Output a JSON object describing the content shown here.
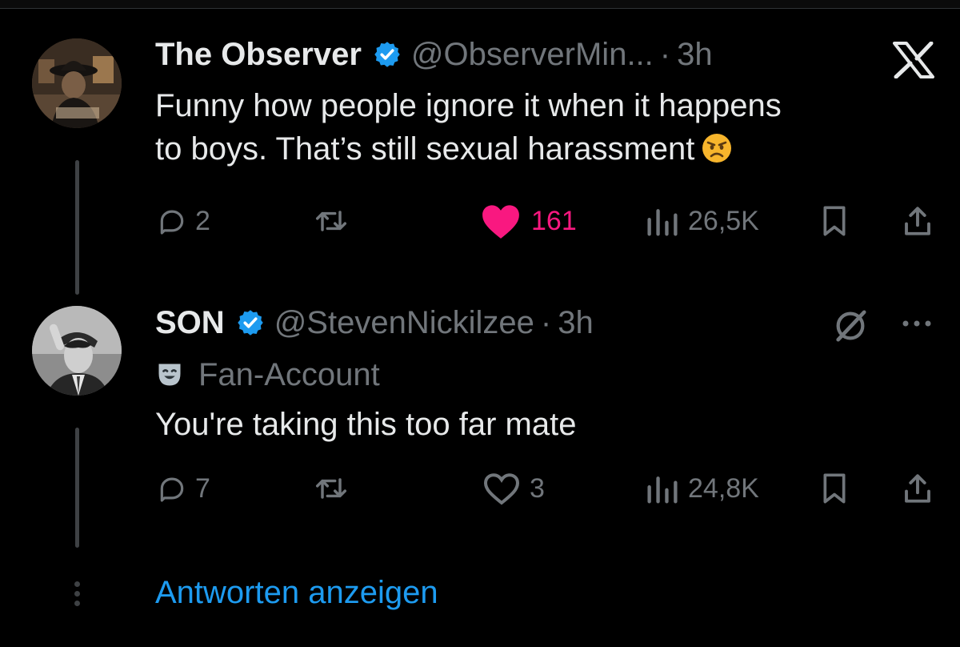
{
  "colors": {
    "background": "#000000",
    "text": "#e7e9ea",
    "muted": "#71767b",
    "accent": "#1d9bf0",
    "like": "#f91880",
    "verified": "#1d9bf0"
  },
  "header_logo_icon": "x-logo-icon",
  "tweets": [
    {
      "display_name": "The Observer",
      "verified": true,
      "handle": "@ObserverMin...",
      "separator": "·",
      "time": "3h",
      "text_lines": [
        "Funny how people ignore it when it happens",
        "to boys. That’s still sexual harassment"
      ],
      "emoji": "angry-face-emoji",
      "actions": {
        "replies": "2",
        "reposts": "",
        "likes": "161",
        "liked": true,
        "views": "26,5K"
      }
    },
    {
      "display_name": "SON",
      "verified": true,
      "handle": "@StevenNickilzee",
      "separator": "·",
      "time": "3h",
      "account_label": "Fan-Account",
      "account_label_icon": "theater-mask-icon",
      "text_lines": [
        "You're taking this too far mate"
      ],
      "actions": {
        "replies": "7",
        "reposts": "",
        "likes": "3",
        "liked": false,
        "views": "24,8K"
      }
    }
  ],
  "show_replies_label": "Antworten anzeigen"
}
